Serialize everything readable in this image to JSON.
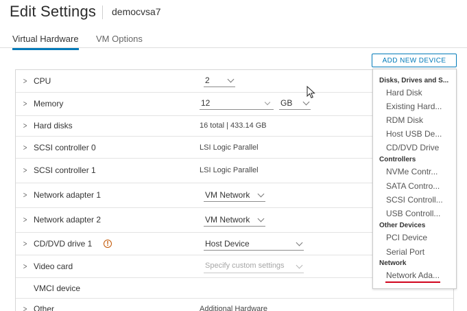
{
  "header": {
    "title": "Edit Settings",
    "vm_name": "democvsa7"
  },
  "tabs": [
    {
      "label": "Virtual Hardware",
      "active": true
    },
    {
      "label": "VM Options",
      "active": false
    }
  ],
  "toolbar": {
    "add_device_label": "ADD NEW DEVICE"
  },
  "hardware": {
    "cpu": {
      "label": "CPU",
      "value": "2"
    },
    "memory": {
      "label": "Memory",
      "value": "12",
      "unit": "GB"
    },
    "hard_disks": {
      "label": "Hard disks",
      "value": "16 total | 433.14 GB"
    },
    "scsi0": {
      "label": "SCSI controller 0",
      "value": "LSI Logic Parallel"
    },
    "scsi1": {
      "label": "SCSI controller 1",
      "value": "LSI Logic Parallel"
    },
    "net1": {
      "label": "Network adapter 1",
      "value": "VM Network"
    },
    "net2": {
      "label": "Network adapter 2",
      "value": "VM Network"
    },
    "cdrom": {
      "label": "CD/DVD drive 1",
      "value": "Host Device"
    },
    "video": {
      "label": "Video card",
      "value": "Specify custom settings"
    },
    "vmci": {
      "label": "VMCI device"
    },
    "other": {
      "label": "Other",
      "value": "Additional Hardware"
    }
  },
  "menu": {
    "disks_header": "Disks, Drives and S...",
    "hard_disk": "Hard Disk",
    "existing": "Existing Hard...",
    "rdm": "RDM Disk",
    "usb_dev": "Host USB De...",
    "cd_dvd": "CD/DVD Drive",
    "controllers_header": "Controllers",
    "nvme": "NVMe Contr...",
    "sata": "SATA Contro...",
    "scsi": "SCSI Controll...",
    "usb_ctrl": "USB Controll...",
    "other_header": "Other Devices",
    "pci": "PCI Device",
    "serial": "Serial Port",
    "network_header": "Network",
    "network_adapter": "Network Ada..."
  },
  "colors": {
    "accent": "#0079b8",
    "warning": "#c25400",
    "highlight_underline": "#d0021b"
  }
}
